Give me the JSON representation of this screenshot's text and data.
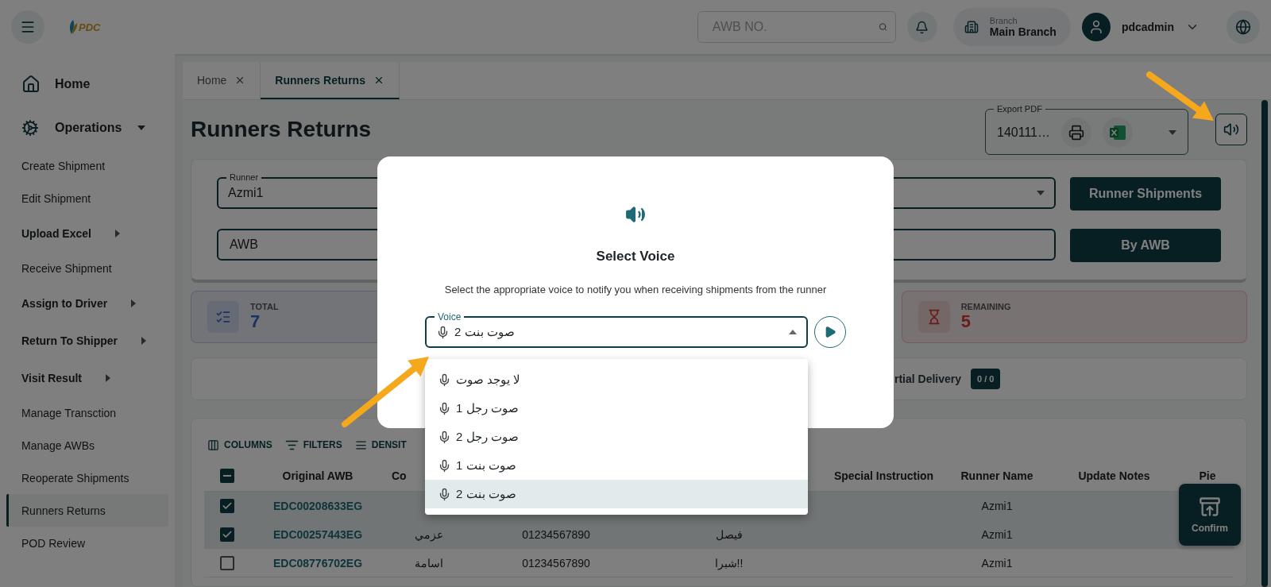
{
  "header": {
    "logo_text": "PDC",
    "search": {
      "placeholder": "AWB NO."
    },
    "branch": {
      "label": "Branch",
      "value": "Main Branch"
    },
    "user": {
      "name": "pdcadmin"
    }
  },
  "sidebar": {
    "items": [
      {
        "label": "Home",
        "kind": "primary",
        "selected": false
      },
      {
        "label": "Operations",
        "kind": "primary",
        "selected": false,
        "expanded": true
      },
      {
        "label": "Create Shipment",
        "kind": "link",
        "selected": false
      },
      {
        "label": "Edit Shipment",
        "kind": "link",
        "selected": false
      },
      {
        "label": "Upload Excel",
        "kind": "group",
        "selected": false,
        "expanded": false
      },
      {
        "label": "Receive Shipment",
        "kind": "link",
        "selected": false
      },
      {
        "label": "Assign to Driver",
        "kind": "group",
        "selected": false,
        "expanded": false
      },
      {
        "label": "Return To Shipper",
        "kind": "group",
        "selected": false,
        "expanded": false
      },
      {
        "label": "Visit Result",
        "kind": "group",
        "selected": false,
        "expanded": false
      },
      {
        "label": "Manage Transction",
        "kind": "link",
        "selected": false
      },
      {
        "label": "Manage AWBs",
        "kind": "link",
        "selected": false
      },
      {
        "label": "Reoperate Shipments",
        "kind": "link",
        "selected": false
      },
      {
        "label": "Runners Returns",
        "kind": "link",
        "selected": true
      },
      {
        "label": "POD Review",
        "kind": "link",
        "selected": false
      }
    ]
  },
  "tabs": [
    {
      "label": "Home",
      "selected": false
    },
    {
      "label": "Runners Returns",
      "selected": true
    }
  ],
  "page_title": "Runners Returns",
  "export": {
    "label": "Export PDF",
    "value": "140111…"
  },
  "filters": {
    "runner": {
      "label": "Runner",
      "value": "Azmi1"
    },
    "awb": {
      "placeholder": "AWB"
    },
    "buttons": [
      "Runner Shipments",
      "By AWB"
    ]
  },
  "stats": [
    {
      "kind": "total",
      "label": "TOTAL",
      "value": "7"
    },
    {
      "kind": "remaining",
      "label": "REMAINING",
      "value": "5"
    }
  ],
  "delivery": {
    "label": "rtial Delivery",
    "count": "0 / 0"
  },
  "table": {
    "toolbar": [
      "COLUMNS",
      "FILTERS",
      "DENSIT"
    ],
    "header_checkbox": {
      "indeterminate": true
    },
    "columns": [
      {
        "label": "Original AWB"
      },
      {
        "label": "Co"
      },
      {},
      {},
      {
        "label": "Special Instruction"
      },
      {
        "label": "Runner Name"
      },
      {
        "label": "Update Notes"
      },
      {
        "label": "Pie"
      }
    ],
    "rows": [
      {
        "selected": true,
        "awb": "EDC00208633EG",
        "runner": "Azmi1"
      },
      {
        "selected": true,
        "awb": "EDC00257443EG",
        "consignee": "عزمي",
        "phone": "01234567890",
        "column_5": "فيصل",
        "runner": "Azmi1"
      },
      {
        "selected": false,
        "awb": "EDC08776702EG",
        "consignee": "اسامة",
        "phone": "01234567890",
        "column_5": "شبرا!!",
        "runner": "Azmi1"
      }
    ]
  },
  "confirm": "Confirm",
  "modal": {
    "title": "Select Voice",
    "description": "Select the appropriate voice to notify you when receiving shipments from the runner",
    "voice": {
      "label": "Voice",
      "value": "صوت بنت 2"
    },
    "options": [
      {
        "label": "لا يوجد صوت",
        "selected": false
      },
      {
        "label": "صوت رجل 1",
        "selected": false
      },
      {
        "label": "صوت رجل 2",
        "selected": false
      },
      {
        "label": "صوت بنت 1",
        "selected": false
      },
      {
        "label": "صوت بنت 2",
        "selected": true
      }
    ]
  }
}
